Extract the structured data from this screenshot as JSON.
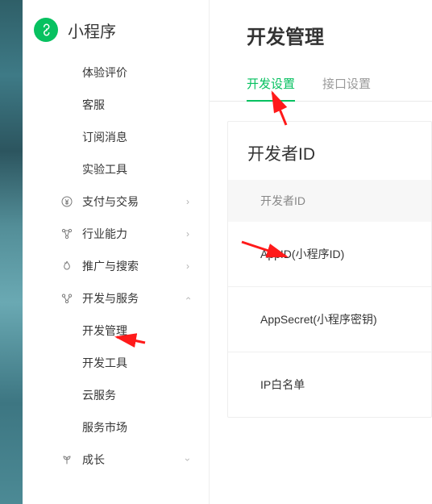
{
  "brand": {
    "title": "小程序"
  },
  "sidebar": {
    "sub1": [
      "体验评价",
      "客服",
      "订阅消息",
      "实验工具"
    ],
    "groups": [
      {
        "icon": "yen-icon",
        "label": "支付与交易",
        "chev": "right"
      },
      {
        "icon": "nodes-icon",
        "label": "行业能力",
        "chev": "right"
      },
      {
        "icon": "flame-icon",
        "label": "推广与搜索",
        "chev": "right"
      },
      {
        "icon": "dev-icon",
        "label": "开发与服务",
        "chev": "up"
      }
    ],
    "devSub": [
      "开发管理",
      "开发工具",
      "云服务",
      "服务市场"
    ],
    "growth": {
      "icon": "plant-icon",
      "label": "成长",
      "chev": "down"
    }
  },
  "main": {
    "title": "开发管理",
    "tabs": [
      "开发设置",
      "接口设置"
    ],
    "card": {
      "title": "开发者ID",
      "head": "开发者ID",
      "rows": [
        "AppID(小程序ID)",
        "AppSecret(小程序密钥)",
        "IP白名单"
      ]
    }
  }
}
